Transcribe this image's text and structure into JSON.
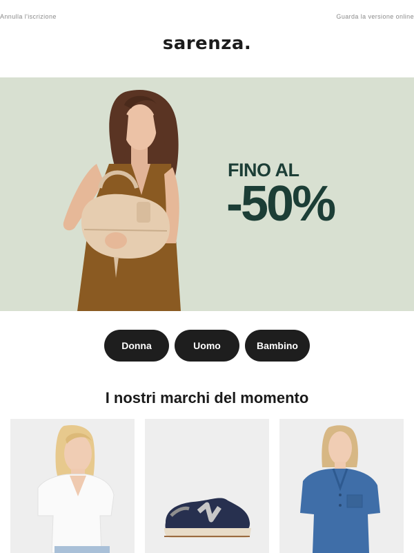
{
  "top_links": {
    "unsubscribe": "Annulla l'iscrizione",
    "view_online": "Guarda la versione online"
  },
  "logo": {
    "text": "sarenza."
  },
  "hero": {
    "line1": "FINO AL",
    "line2": "-50%",
    "background": "#d8e0d1",
    "text_color": "#1c3e36"
  },
  "categories": [
    {
      "label": "Donna"
    },
    {
      "label": "Uomo"
    },
    {
      "label": "Bambino"
    }
  ],
  "brands_section": {
    "title": "I nostri marchi del momento"
  },
  "icons": {
    "hero_image": "woman-with-handbag-photo",
    "brand_1": "white-tshirt-model-photo",
    "brand_2": "navy-sneaker-photo",
    "brand_3": "denim-shirt-model-photo"
  }
}
